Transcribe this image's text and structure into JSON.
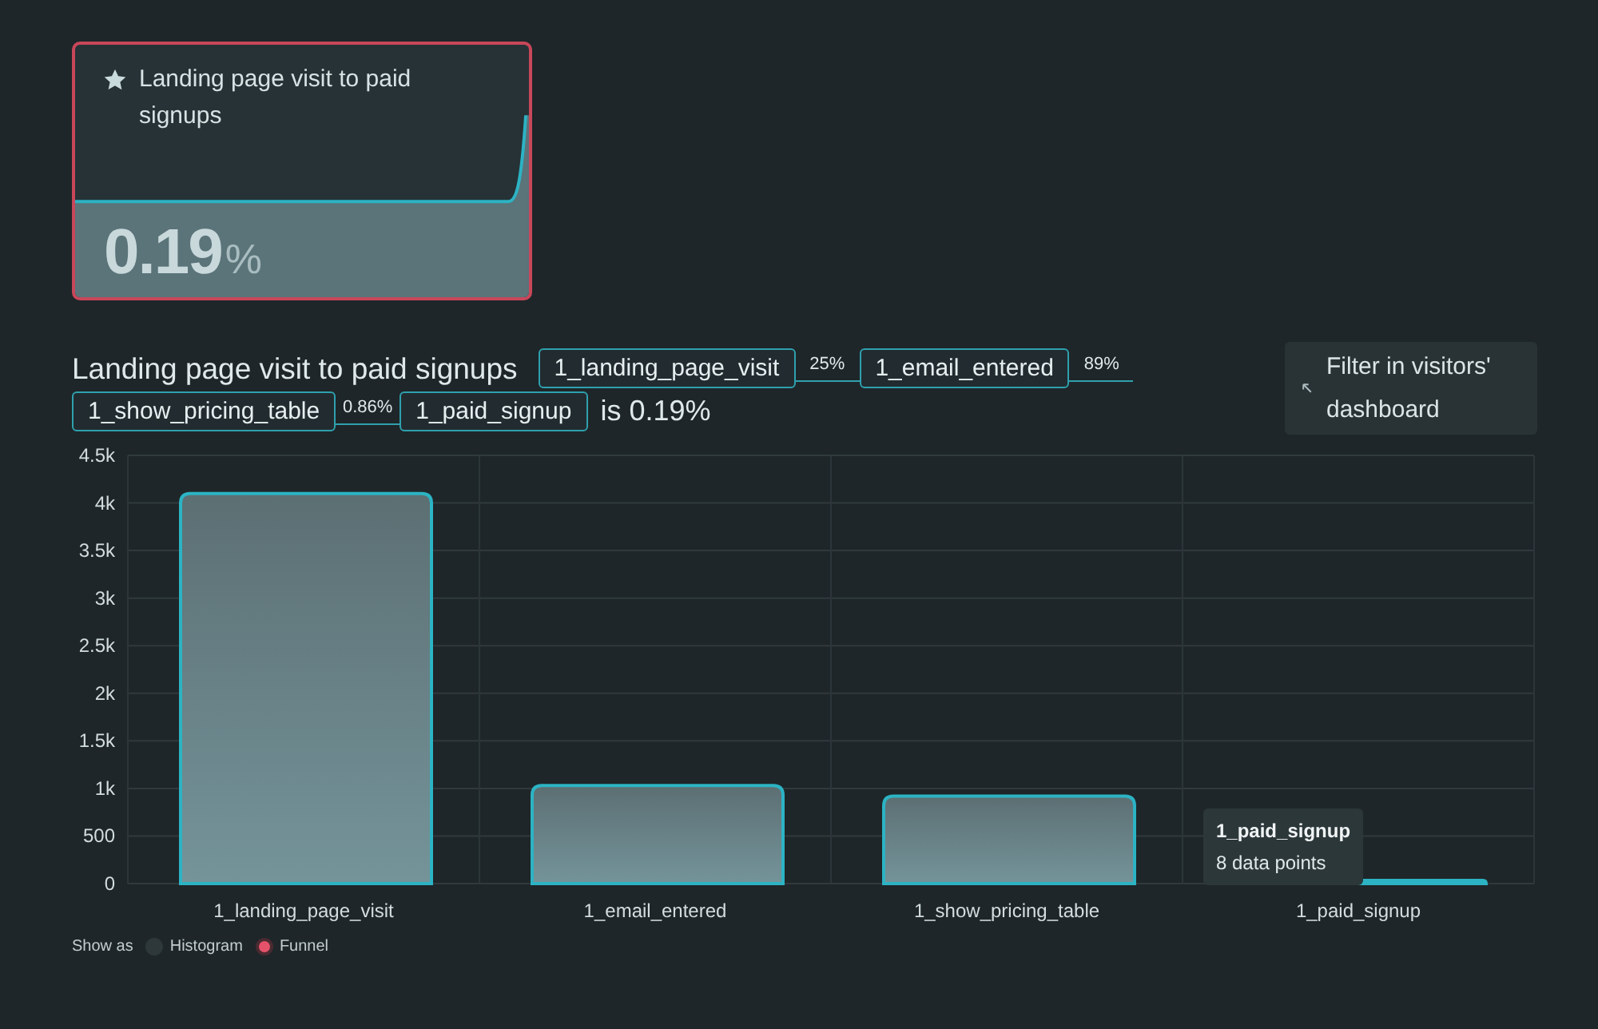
{
  "card": {
    "title": "Landing page visit to paid signups",
    "value": "0.19",
    "unit": "%"
  },
  "funnel": {
    "title": "Landing page visit to paid signups",
    "steps": [
      {
        "name": "1_landing_page_visit",
        "conversion": "25%"
      },
      {
        "name": "1_email_entered",
        "conversion": "89%"
      },
      {
        "name": "1_show_pricing_table",
        "conversion": "0.86%"
      },
      {
        "name": "1_paid_signup"
      }
    ],
    "result": "is 0.19%"
  },
  "filter_button": {
    "label": "Filter in visitors' dashboard"
  },
  "chart": {
    "chart_data": {
      "type": "bar",
      "categories": [
        "1_landing_page_visit",
        "1_email_entered",
        "1_show_pricing_table",
        "1_paid_signup"
      ],
      "values": [
        4100,
        1030,
        920,
        0
      ],
      "grid": true,
      "ylim": [
        0,
        4500
      ],
      "yticks": [
        {
          "value": 0,
          "label": "0"
        },
        {
          "value": 500,
          "label": "500"
        },
        {
          "value": 1000,
          "label": "1k"
        },
        {
          "value": 1500,
          "label": "1.5k"
        },
        {
          "value": 2000,
          "label": "2k"
        },
        {
          "value": 2500,
          "label": "2.5k"
        },
        {
          "value": 3000,
          "label": "3k"
        },
        {
          "value": 3500,
          "label": "3.5k"
        },
        {
          "value": 4000,
          "label": "4k"
        },
        {
          "value": 4500,
          "label": "4.5k"
        }
      ]
    },
    "tooltip": {
      "title": "1_paid_signup",
      "detail": "8 data points"
    }
  },
  "show_as": {
    "label": "Show as",
    "options": [
      {
        "label": "Histogram",
        "selected": false
      },
      {
        "label": "Funnel",
        "selected": true
      }
    ]
  }
}
